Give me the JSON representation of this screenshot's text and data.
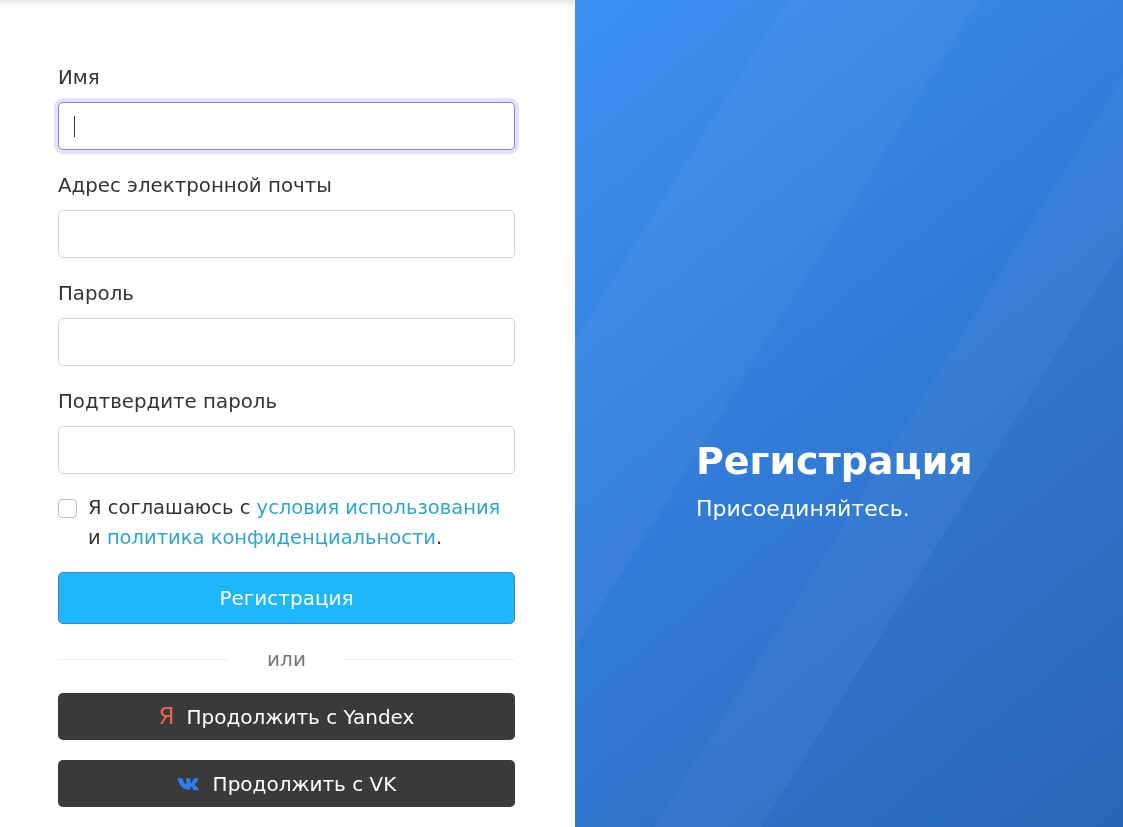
{
  "form": {
    "fields": [
      {
        "label": "Имя",
        "focused": true
      },
      {
        "label": "Адрес электронной почты",
        "focused": false
      },
      {
        "label": "Пароль",
        "focused": false
      },
      {
        "label": "Подтвердите пароль",
        "focused": false
      }
    ],
    "consent": {
      "checked": false,
      "text": "Я соглашаюсь с",
      "terms_link": "условия использования",
      "conjunction": "и",
      "privacy_link": "политика конфиденциальности",
      "ending": "."
    },
    "submit_button": "Регистрация",
    "divider": "или",
    "social_buttons": [
      {
        "kind": "yandex",
        "icon": "Я",
        "label": "Продолжить с Yandex"
      },
      {
        "kind": "vk",
        "label": "Продолжить с VK"
      }
    ]
  },
  "hero": {
    "title": "Регистрация",
    "subtitle": "Присоединяйтесь."
  }
}
